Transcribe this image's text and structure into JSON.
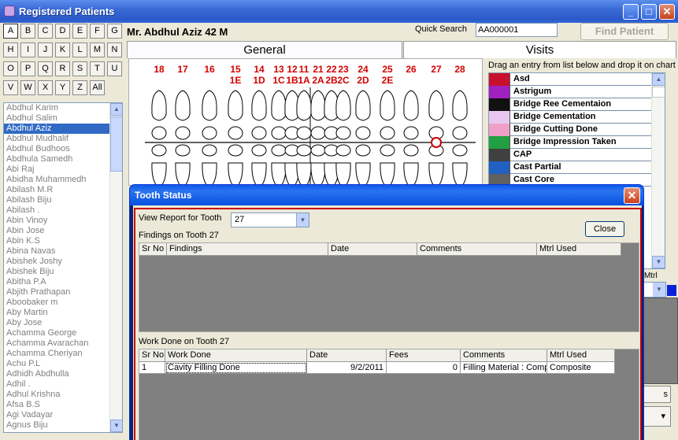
{
  "window": {
    "title": "Registered Patients"
  },
  "letters": [
    "A",
    "B",
    "C",
    "D",
    "E",
    "F",
    "G",
    "H",
    "I",
    "J",
    "K",
    "L",
    "M",
    "N",
    "O",
    "P",
    "Q",
    "R",
    "S",
    "T",
    "U",
    "V",
    "W",
    "X",
    "Y",
    "Z",
    "All"
  ],
  "patients": [
    "Abdhul Karim",
    "Abdhul Salim",
    "Abdhul Aziz",
    "Abdhul Mudhalif",
    "Abdhul Budhoos",
    "Abdhula Samedh",
    "Abi Raj",
    "Abidha Muhammedh",
    "Abilash M.R",
    "Abilash Biju",
    "Abilash .",
    "Abin Vinoy",
    "Abin Jose",
    "Abin K.S",
    "Abina Navas",
    "Abishek Joshy",
    "Abishek Biju",
    "Abitha P.A",
    "Abjith Prathapan",
    "Aboobaker m",
    "Aby Martin",
    "Aby Jose",
    "Achamma George",
    "Achamma Avarachan",
    "Achamma Cheriyan",
    "Achu P.L",
    "Adhidh Abdhulla",
    "Adhil .",
    "Adhul Krishna",
    "Afsa B.S",
    "Agi Vadayar",
    "Agnus Biju"
  ],
  "selected_patient": "Abdhul Aziz",
  "header": {
    "patient": "Mr. Abdhul  Aziz 42 M",
    "quick_search_label": "Quick Search",
    "quick_search_value": "AA000001",
    "find_button": "Find Patient"
  },
  "tabs": {
    "general": "General",
    "visits": "Visits"
  },
  "chart": {
    "top_numbers": [
      "18",
      "17",
      "16",
      "15",
      "14",
      "13",
      "12",
      "11",
      "21",
      "22",
      "23",
      "24",
      "25",
      "26",
      "27",
      "28"
    ],
    "sub_numbers": [
      "1E",
      "1D",
      "1C",
      "1B",
      "1A",
      "2A",
      "2B",
      "2C",
      "2D",
      "2E"
    ]
  },
  "visits": {
    "hint": "Drag an entry from list below and drop it on chart",
    "items": [
      {
        "label": "Asd",
        "color": "#c8102e"
      },
      {
        "label": "Astrigum",
        "color": "#a020c0"
      },
      {
        "label": "Bridge  Ree   Cementaion",
        "color": "#111111"
      },
      {
        "label": "Bridge Cementation",
        "color": "#e8c8f0"
      },
      {
        "label": "Bridge Cutting Done",
        "color": "#f0a0c8"
      },
      {
        "label": "Bridge Impression Taken",
        "color": "#20a040"
      },
      {
        "label": "CAP",
        "color": "#404040"
      },
      {
        "label": "Cast  Partial",
        "color": "#2060c0"
      },
      {
        "label": "Cast Core",
        "color": "#606060"
      }
    ],
    "mtrl_label": "Mtrl",
    "side_button": "s"
  },
  "dialog": {
    "title": "Tooth Status",
    "view_report_label": "View Report for Tooth",
    "tooth_value": "27",
    "close_button": "Close",
    "findings_label": "Findings on Tooth 27",
    "findings_columns": [
      "Sr No",
      "Findings",
      "Date",
      "Comments",
      "Mtrl Used"
    ],
    "work_label": "Work Done  on Tooth 27",
    "work_columns": [
      "Sr No",
      "Work Done",
      "Date",
      "Fees",
      "Comments",
      "Mtrl Used"
    ],
    "work_rows": [
      {
        "sr": "1",
        "work": "Cavity Filling Done",
        "date": "9/2/2011",
        "fees": "0",
        "comments": "Filling Material : Comp",
        "mtrl": "Composite"
      }
    ]
  }
}
